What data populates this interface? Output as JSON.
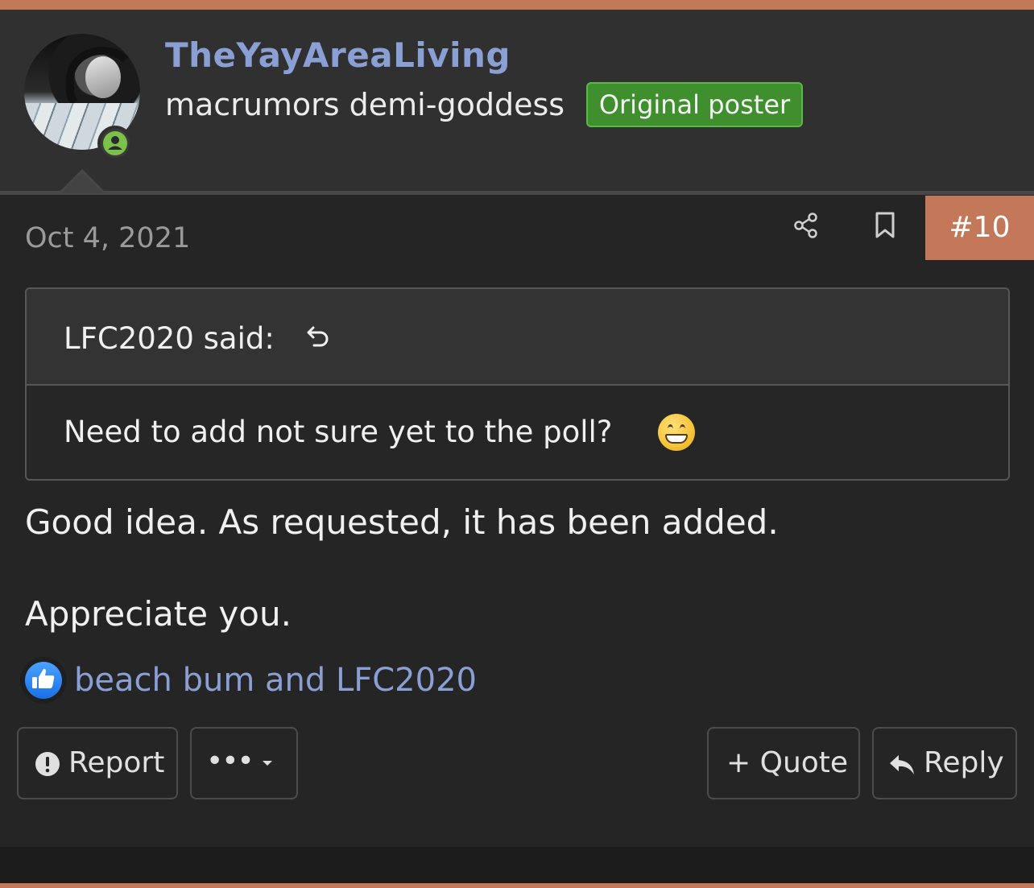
{
  "post": {
    "author": {
      "username": "TheYayAreaLiving",
      "user_title": "macrumors demi-goddess",
      "badge": "Original poster",
      "online_status_icon": "user-online-icon"
    },
    "date": "Oct 4, 2021",
    "number": "#10",
    "quote": {
      "author_line": "LFC2020 said:",
      "text": "Need to add not sure yet to the poll?",
      "emoji": "grinning-face-emoji"
    },
    "body": {
      "line1": "Good idea. As requested, it has been added.",
      "line2": "Appreciate you."
    },
    "reactions": {
      "icon": "thumbs-up-icon",
      "text": "beach bum and LFC2020"
    },
    "actions": {
      "report": "Report",
      "more": "•••",
      "quote": "+ Quote",
      "reply": "Reply"
    }
  },
  "colors": {
    "accent": "#c4785a",
    "username": "#8aa0d4",
    "badge_bg": "#3f8f2e",
    "online": "#7cc24a",
    "background": "#252525"
  }
}
